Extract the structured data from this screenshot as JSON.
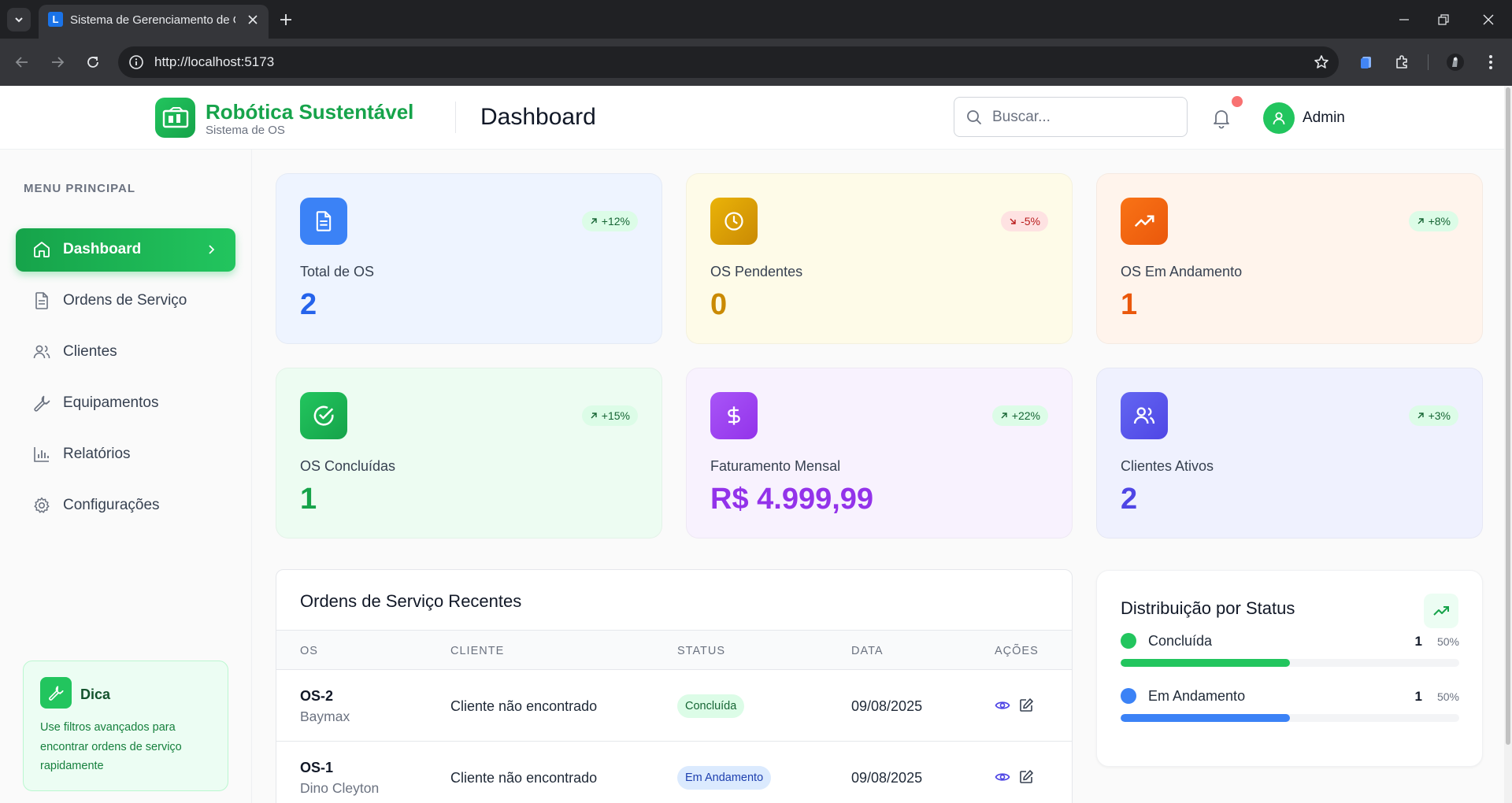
{
  "browser": {
    "tab_title": "Sistema de Gerenciamento de O",
    "favicon_letter": "L",
    "url": "http://localhost:5173"
  },
  "header": {
    "brand_name": "Robótica Sustentável",
    "brand_sub": "Sistema de OS",
    "page_title": "Dashboard",
    "search_placeholder": "Buscar...",
    "search_value": "",
    "user_name": "Admin"
  },
  "sidebar": {
    "heading": "MENU PRINCIPAL",
    "items": [
      {
        "label": "Dashboard",
        "icon": "home-icon",
        "active": true
      },
      {
        "label": "Ordens de Serviço",
        "icon": "document-icon",
        "active": false
      },
      {
        "label": "Clientes",
        "icon": "users-icon",
        "active": false
      },
      {
        "label": "Equipamentos",
        "icon": "wrench-icon",
        "active": false
      },
      {
        "label": "Relatórios",
        "icon": "bar-chart-icon",
        "active": false
      },
      {
        "label": "Configurações",
        "icon": "gear-icon",
        "active": false
      }
    ],
    "tip": {
      "title": "Dica",
      "text": "Use filtros avançados para encontrar ordens de serviço rapidamente"
    }
  },
  "stats": [
    {
      "label": "Total de OS",
      "value": "2",
      "badge": "+12%",
      "trend": "up",
      "icon": "document-icon",
      "color": "#2563eb"
    },
    {
      "label": "OS Pendentes",
      "value": "0",
      "badge": "-5%",
      "trend": "down",
      "icon": "clock-icon",
      "color": "#ca8a04"
    },
    {
      "label": "OS Em Andamento",
      "value": "1",
      "badge": "+8%",
      "trend": "up",
      "icon": "trending-up-icon",
      "color": "#ea580c"
    },
    {
      "label": "OS Concluídas",
      "value": "1",
      "badge": "+15%",
      "trend": "up",
      "icon": "check-circle-icon",
      "color": "#16a34a"
    },
    {
      "label": "Faturamento Mensal",
      "value": "R$ 4.999,99",
      "badge": "+22%",
      "trend": "up",
      "icon": "dollar-icon",
      "color": "#9333ea"
    },
    {
      "label": "Clientes Ativos",
      "value": "2",
      "badge": "+3%",
      "trend": "up",
      "icon": "users-icon",
      "color": "#4f46e5"
    }
  ],
  "orders": {
    "title": "Ordens de Serviço Recentes",
    "columns": [
      "OS",
      "CLIENTE",
      "STATUS",
      "DATA",
      "AÇÕES"
    ],
    "rows": [
      {
        "id": "OS-2",
        "equipment": "Baymax",
        "client": "Cliente não encontrado",
        "status": "Concluída",
        "date": "09/08/2025"
      },
      {
        "id": "OS-1",
        "equipment": "Dino Cleyton",
        "client": "Cliente não encontrado",
        "status": "Em Andamento",
        "date": "09/08/2025"
      }
    ]
  },
  "distribution": {
    "title": "Distribuição por Status",
    "items": [
      {
        "name": "Concluída",
        "count": "1",
        "percent": "50%",
        "fraction": 0.5,
        "color": "#22c55e"
      },
      {
        "name": "Em Andamento",
        "count": "1",
        "percent": "50%",
        "fraction": 0.5,
        "color": "#3b82f6"
      }
    ]
  }
}
